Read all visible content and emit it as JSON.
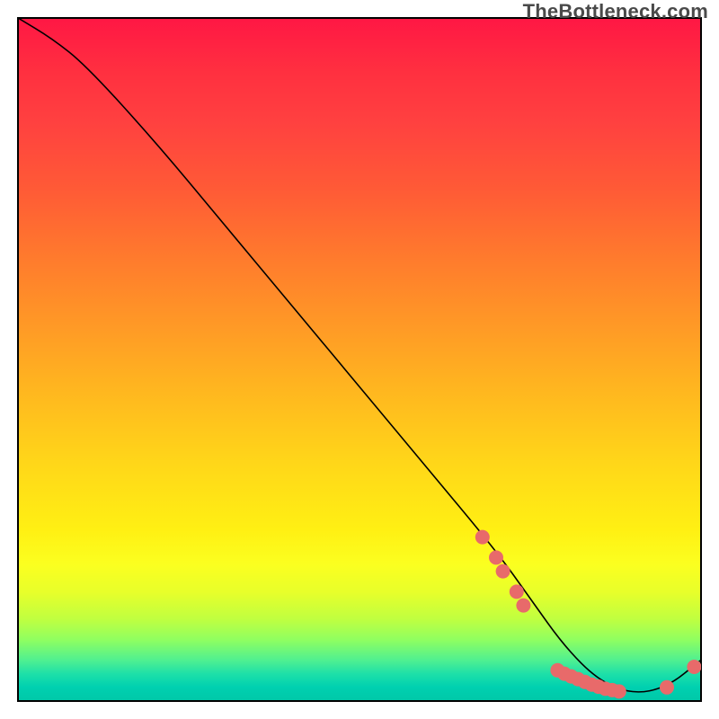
{
  "attribution": "TheBottleneck.com",
  "chart_data": {
    "type": "line",
    "title": "",
    "xlabel": "",
    "ylabel": "",
    "xlim": [
      0,
      100
    ],
    "ylim": [
      0,
      100
    ],
    "grid": false,
    "legend": false,
    "series": [
      {
        "name": "curve",
        "x": [
          0,
          5,
          10,
          20,
          30,
          40,
          50,
          60,
          70,
          75,
          80,
          85,
          90,
          95,
          100
        ],
        "y": [
          100,
          97,
          93,
          82,
          70,
          58,
          46,
          34,
          22,
          15,
          8,
          3,
          1,
          2,
          6
        ]
      }
    ],
    "markers": [
      {
        "x": 68,
        "y": 24
      },
      {
        "x": 70,
        "y": 21
      },
      {
        "x": 71,
        "y": 19
      },
      {
        "x": 73,
        "y": 16
      },
      {
        "x": 74,
        "y": 14
      },
      {
        "x": 79,
        "y": 4.5
      },
      {
        "x": 80,
        "y": 4.0
      },
      {
        "x": 81,
        "y": 3.6
      },
      {
        "x": 82,
        "y": 3.2
      },
      {
        "x": 83,
        "y": 2.8
      },
      {
        "x": 84,
        "y": 2.4
      },
      {
        "x": 85,
        "y": 2.1
      },
      {
        "x": 86,
        "y": 1.8
      },
      {
        "x": 87,
        "y": 1.6
      },
      {
        "x": 88,
        "y": 1.4
      },
      {
        "x": 95,
        "y": 2.0
      },
      {
        "x": 99,
        "y": 5.0
      }
    ],
    "marker_style": {
      "color": "#e86a6a",
      "radius_px": 8
    }
  }
}
